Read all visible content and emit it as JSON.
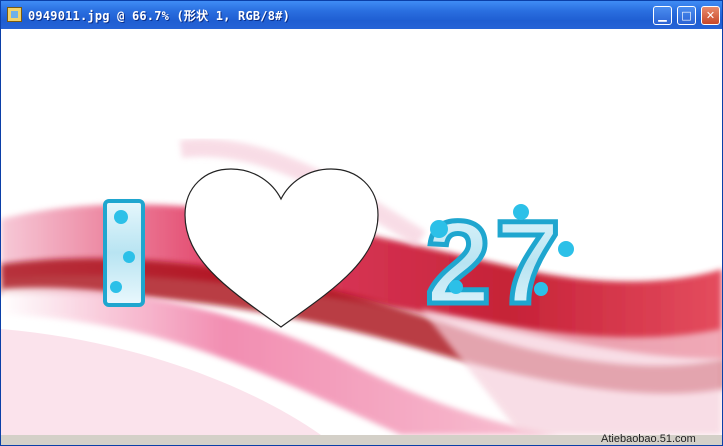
{
  "window": {
    "title": "0949011.jpg @ 66.7% (形状 1, RGB/8#)",
    "buttons": {
      "minimize": "▁",
      "maximize": "□",
      "close": "✕"
    }
  },
  "artwork": {
    "letter_i": "I",
    "number": "27"
  },
  "watermark": "Atiebaobao.51.com",
  "colors": {
    "titlebar": "#2a6fe0",
    "ribbon_red": "#d7102a",
    "ribbon_pink": "#ee6fa0",
    "glass_cyan": "#2cc0e8"
  }
}
